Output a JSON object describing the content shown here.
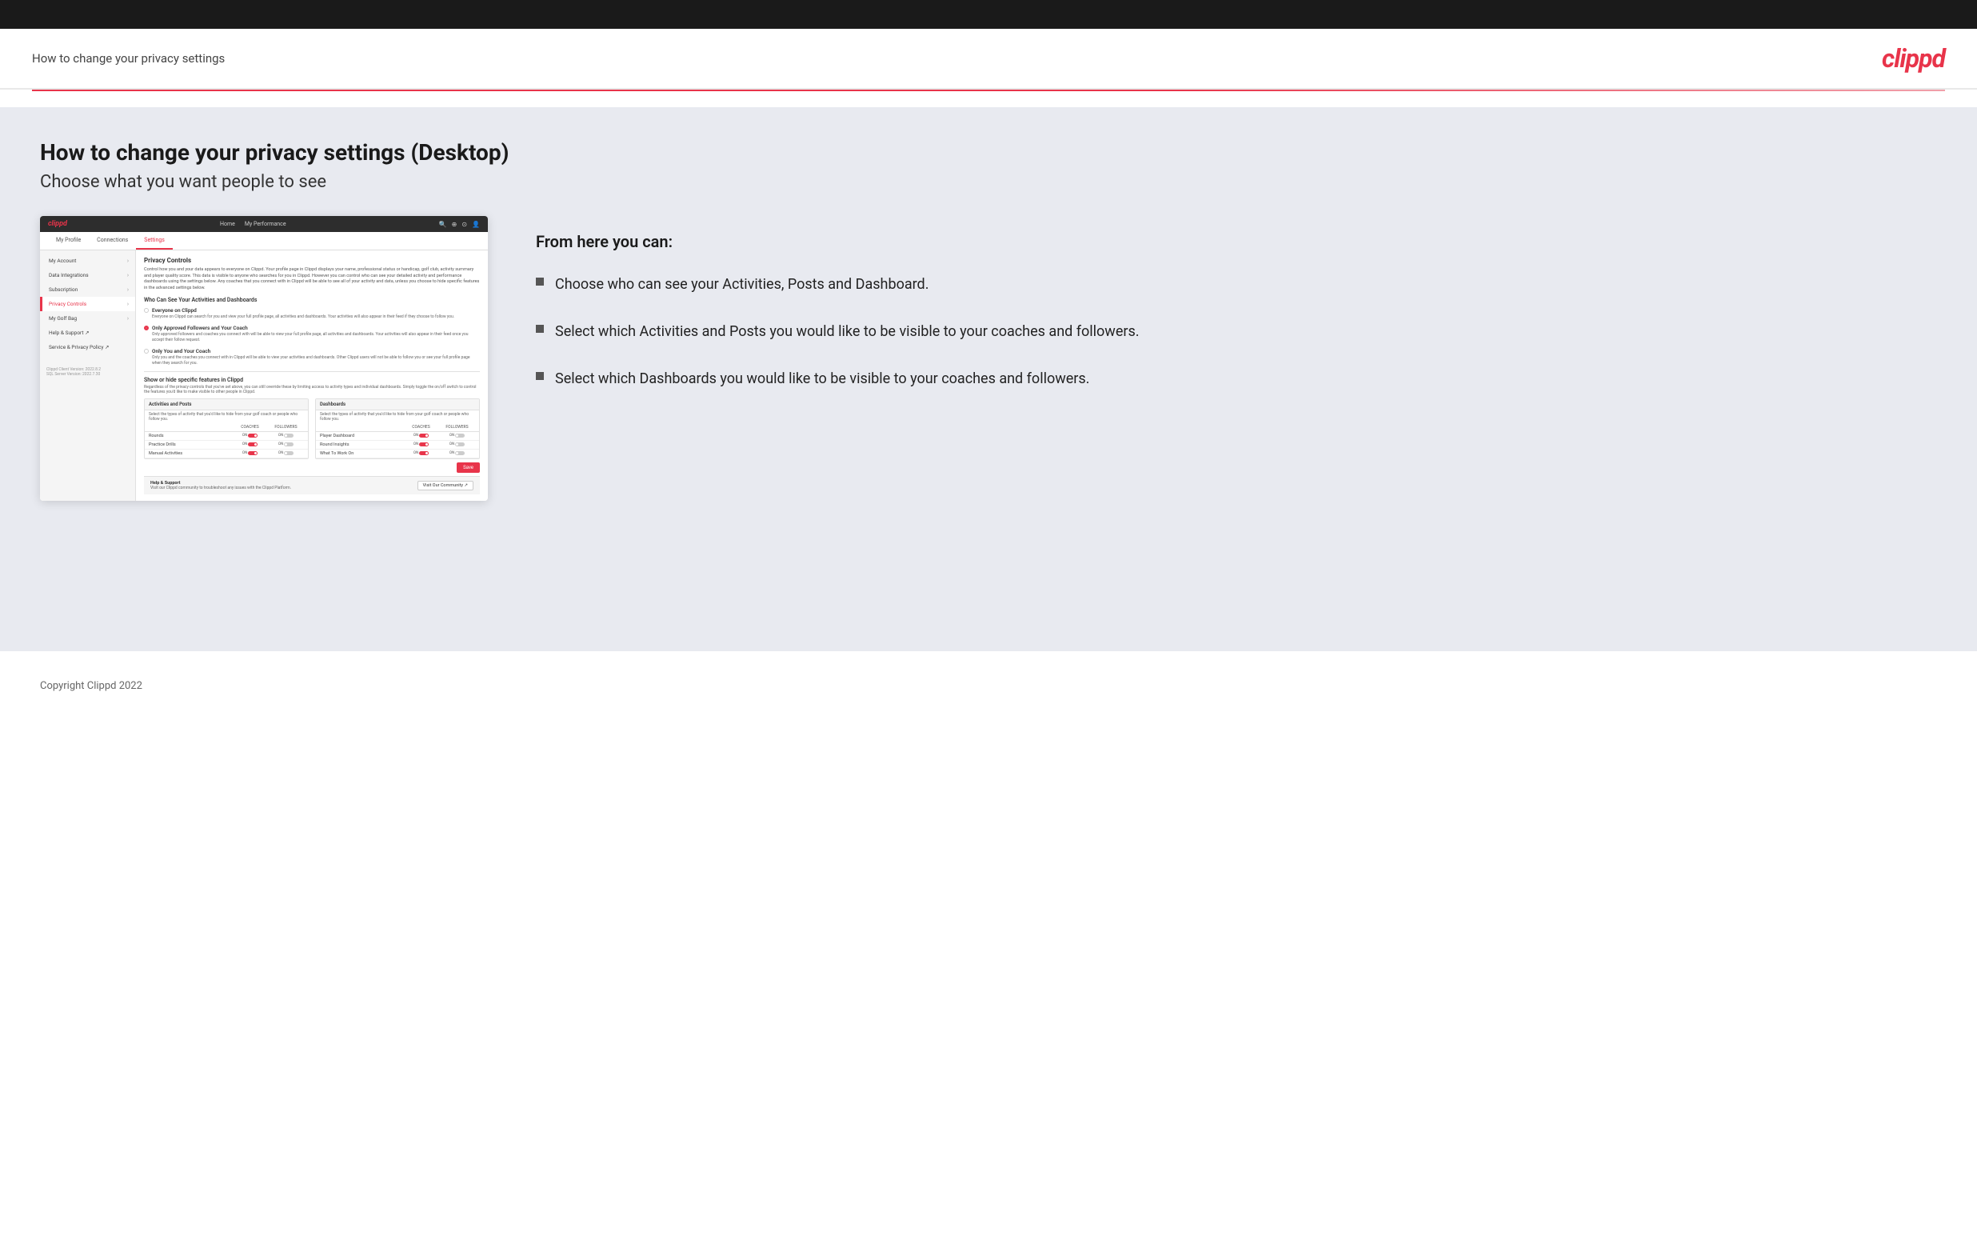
{
  "topBar": {},
  "header": {
    "title": "How to change your privacy settings",
    "logo": "clippd"
  },
  "main": {
    "title": "How to change your privacy settings (Desktop)",
    "subtitle": "Choose what you want people to see",
    "fromHere": "From here you can:",
    "bullets": [
      "Choose who can see your Activities, Posts and Dashboard.",
      "Select which Activities and Posts you would like to be visible to your coaches and followers.",
      "Select which Dashboards you would like to be visible to your coaches and followers."
    ],
    "appMockup": {
      "nav": {
        "logo": "clippd",
        "links": [
          "Home",
          "My Performance"
        ],
        "icons": [
          "🔍",
          "⊕",
          "⊙",
          "👤"
        ]
      },
      "tabs": [
        "My Profile",
        "Connections",
        "Settings"
      ],
      "activeTab": "Settings",
      "sidebar": {
        "items": [
          {
            "label": "My Account",
            "active": false
          },
          {
            "label": "Data Integrations",
            "active": false
          },
          {
            "label": "Subscription",
            "active": false
          },
          {
            "label": "Privacy Controls",
            "active": true
          },
          {
            "label": "My Golf Bag",
            "active": false
          },
          {
            "label": "Help & Support ↗",
            "active": false
          },
          {
            "label": "Service & Privacy Policy ↗",
            "active": false
          }
        ],
        "version": "Clippd Client Version: 2022.8.2\nSQL Server Version: 2022.7.30"
      },
      "privacyControls": {
        "title": "Privacy Controls",
        "description": "Control how you and your data appears to everyone on Clippd. Your profile page in Clippd displays your name, professional status or handicap, golf club, activity summary and player quality score. This data is visible to anyone who searches for you in Clippd. However you can control who can see your detailed activity and performance dashboards using the settings below. Any coaches that you connect with in Clippd will be able to see all of your activity and data, unless you choose to hide specific features in the advanced settings below.",
        "whoCanSeeTitle": "Who Can See Your Activities and Dashboards",
        "radioOptions": [
          {
            "label": "Everyone on Clippd",
            "desc": "Everyone on Clippd can search for you and view your full profile page, all activities and dashboards. Your activities will also appear in their feed if they choose to follow you.",
            "selected": false
          },
          {
            "label": "Only Approved Followers and Your Coach",
            "desc": "Only approved followers and coaches you connect with will be able to view your full profile page, all activities and dashboards. Your activities will also appear in their feed once you accept their follow request.",
            "selected": true
          },
          {
            "label": "Only You and Your Coach",
            "desc": "Only you and the coaches you connect with in Clippd will be able to view your activities and dashboards. Other Clippd users will not be able to follow you or see your full profile page when they search for you.",
            "selected": false
          }
        ],
        "showHideTitle": "Show or hide specific features in Clippd",
        "showHideDesc": "Regardless of the privacy controls that you've set above, you can still override these by limiting access to activity types and individual dashboards. Simply toggle the on/off switch to control the features you'd like to make visible to other people in Clippd.",
        "activitiesTable": {
          "title": "Activities and Posts",
          "desc": "Select the types of activity that you'd like to hide from your golf coach or people who follow you.",
          "columns": [
            "COACHES",
            "FOLLOWERS"
          ],
          "rows": [
            {
              "label": "Rounds",
              "coaches": true,
              "followers": true
            },
            {
              "label": "Practice Drills",
              "coaches": true,
              "followers": true
            },
            {
              "label": "Manual Activities",
              "coaches": true,
              "followers": true
            }
          ]
        },
        "dashboardsTable": {
          "title": "Dashboards",
          "desc": "Select the types of activity that you'd like to hide from your golf coach or people who follow you.",
          "columns": [
            "COACHES",
            "FOLLOWERS"
          ],
          "rows": [
            {
              "label": "Player Dashboard",
              "coaches": true,
              "followers": true
            },
            {
              "label": "Round Insights",
              "coaches": true,
              "followers": true
            },
            {
              "label": "What To Work On",
              "coaches": true,
              "followers": true
            }
          ]
        },
        "saveButton": "Save"
      },
      "helpSection": {
        "title": "Help & Support",
        "desc": "Visit our Clippd community to troubleshoot any issues with the Clippd Platform.",
        "button": "Visit Our Community ↗"
      }
    }
  },
  "footer": {
    "copyright": "Copyright Clippd 2022"
  }
}
